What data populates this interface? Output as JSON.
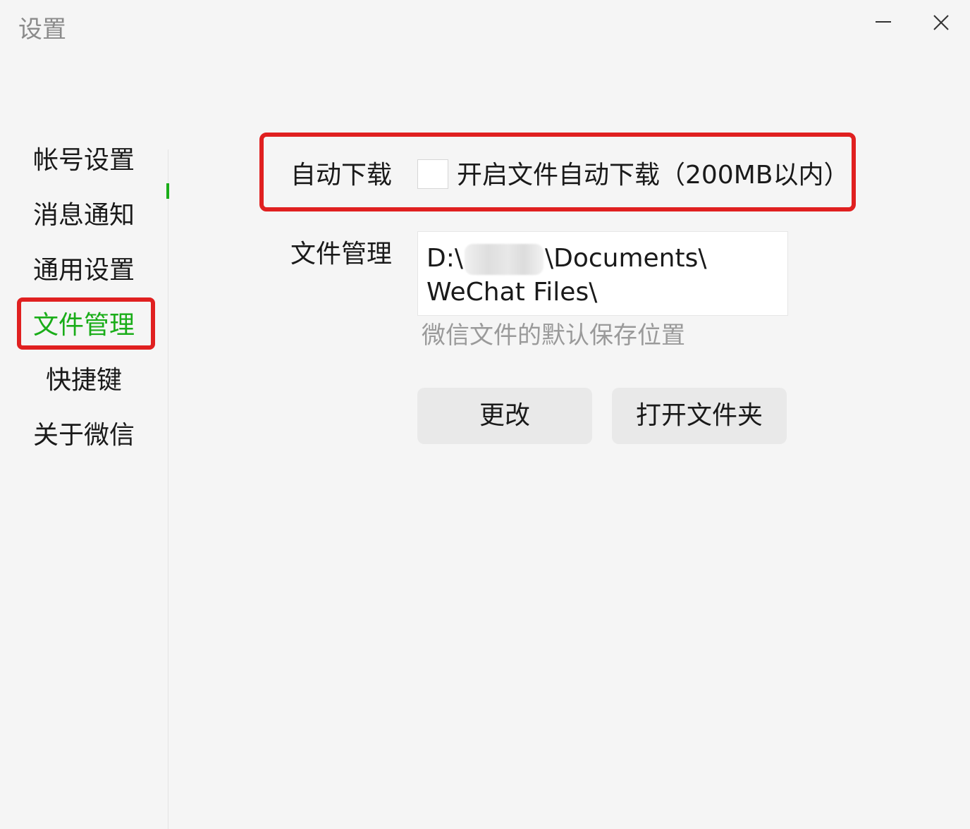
{
  "window": {
    "title": "设置",
    "minimize_icon": "minimize-icon",
    "close_icon": "close-icon"
  },
  "sidebar": {
    "items": [
      {
        "label": "帐号设置",
        "active": false
      },
      {
        "label": "消息通知",
        "active": false
      },
      {
        "label": "通用设置",
        "active": false
      },
      {
        "label": "文件管理",
        "active": true
      },
      {
        "label": "快捷键",
        "active": false
      },
      {
        "label": "关于微信",
        "active": false
      }
    ]
  },
  "file_settings": {
    "auto_download_label": "自动下载",
    "auto_download_checkbox_checked": false,
    "auto_download_text": "开启文件自动下载（200MB以内）",
    "file_management_label": "文件管理",
    "path_prefix": "D:\\",
    "path_suffix": "\\Documents\\",
    "path_line2": "WeChat Files\\",
    "path_hint": "微信文件的默认保存位置",
    "change_button": "更改",
    "open_folder_button": "打开文件夹"
  },
  "colors": {
    "accent_green": "#1aad19",
    "highlight_red": "#e02020",
    "background": "#f5f5f5"
  }
}
